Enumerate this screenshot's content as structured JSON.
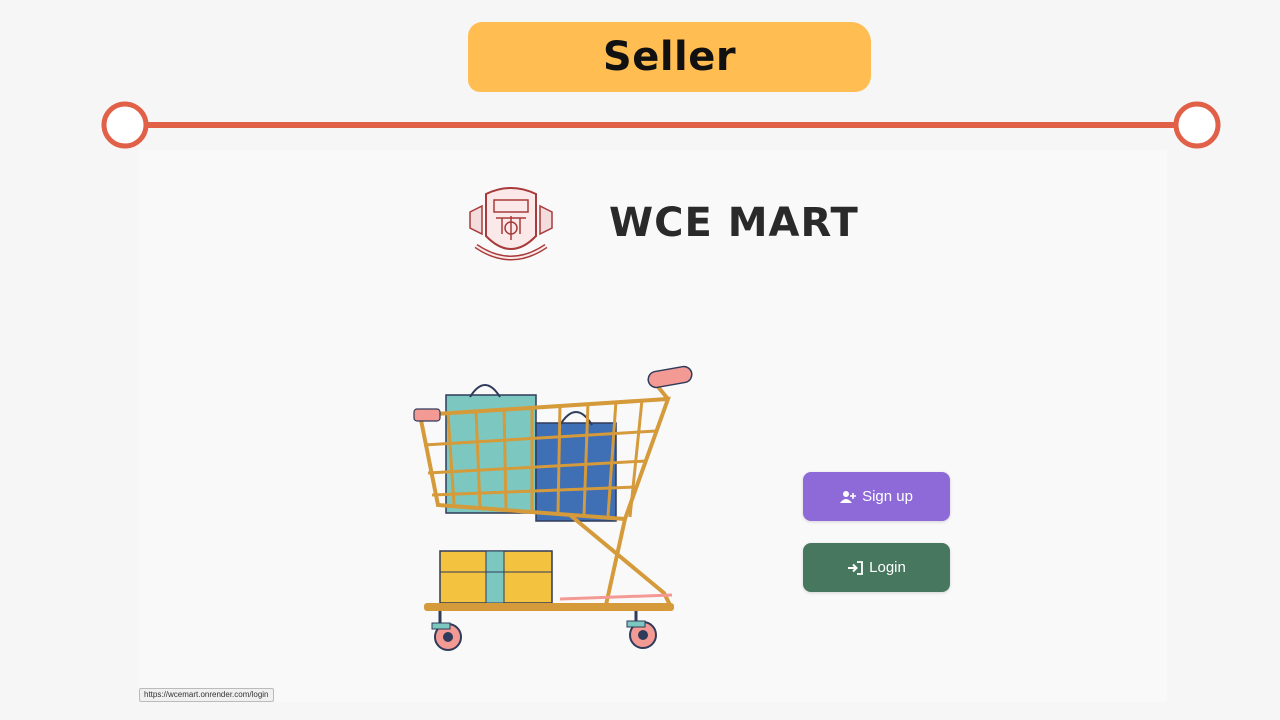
{
  "slide": {
    "title": "Seller",
    "colors": {
      "banner": "#ffbd52",
      "timeline": "#e06048"
    }
  },
  "app": {
    "brand_name": "WCE MART",
    "logo_icon": "college-crest-icon",
    "illustration": "shopping-cart-illustration",
    "buttons": {
      "signup_label": "Sign up",
      "signup_icon": "user-plus-icon",
      "login_label": "Login",
      "login_icon": "sign-in-icon"
    },
    "colors": {
      "signup": "#8d6ad8",
      "login": "#47775f"
    }
  },
  "browser": {
    "status_url": "https://wcemart.onrender.com/login"
  }
}
